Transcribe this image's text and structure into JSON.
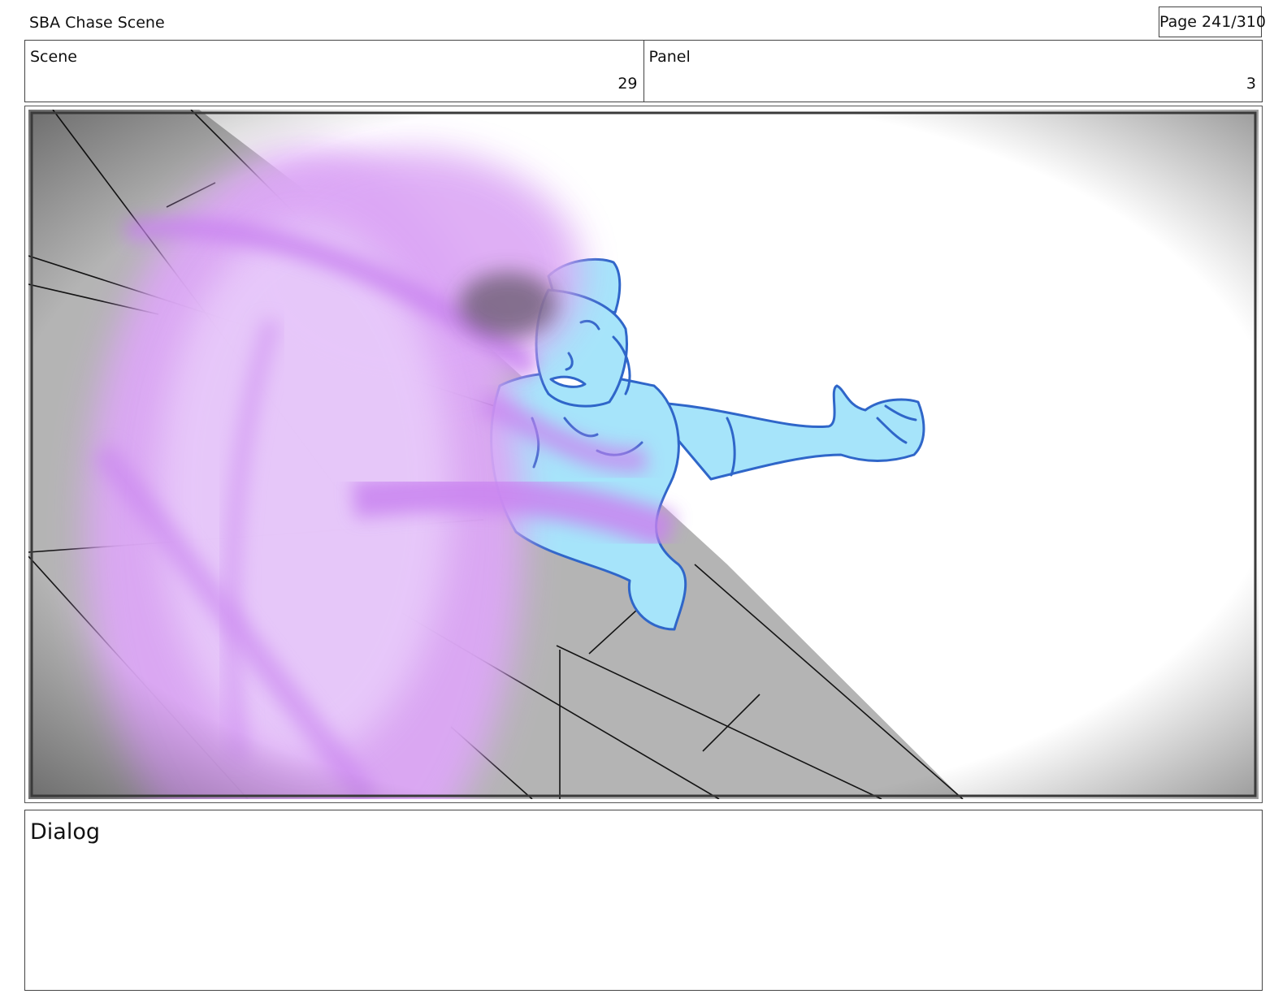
{
  "header": {
    "title": "SBA Chase Scene",
    "page": "Page 241/310"
  },
  "info": {
    "scene_label": "Scene",
    "scene_value": "29",
    "panel_label": "Panel",
    "panel_value": "3"
  },
  "dialog": {
    "label": "Dialog"
  },
  "colors": {
    "character_fill": "#a6e4fa",
    "character_line": "#2f66c9",
    "energy_blast": "#cf8ff2",
    "floor_gray": "#b4b4b4"
  }
}
